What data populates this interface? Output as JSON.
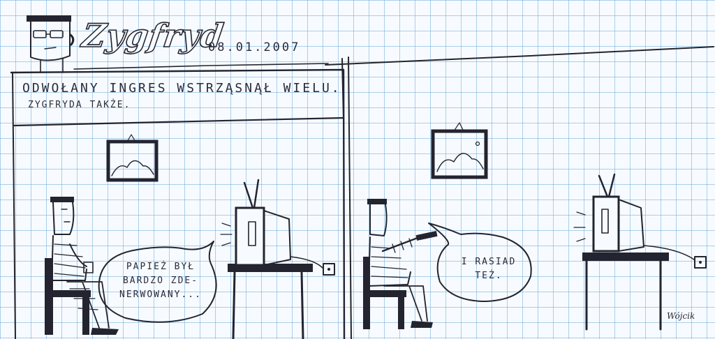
{
  "comic": {
    "title": "Zygfryd",
    "date": "08.01.2007",
    "caption_line1": "ODWOŁANY INGRES WSTRZĄSNĄŁ WIELU.",
    "caption_line2": "ZYGFRYDA TAKŻE.",
    "panel1": {
      "speech_line1": "PAPIEŻ BYŁ",
      "speech_line2": "BARDZO ZDE-",
      "speech_line3": "NERWOWANY..."
    },
    "panel2": {
      "speech_line1": "I RASIAD",
      "speech_line2": "TEŻ."
    },
    "signature": "Wójcik"
  },
  "colors": {
    "ink": "#23242f",
    "paper": "#f7fbff",
    "grid": "#6eaad7"
  },
  "icons": [
    "character-portrait-icon",
    "framed-picture-icon",
    "television-icon",
    "armchair-icon",
    "table-icon",
    "wall-socket-icon"
  ]
}
